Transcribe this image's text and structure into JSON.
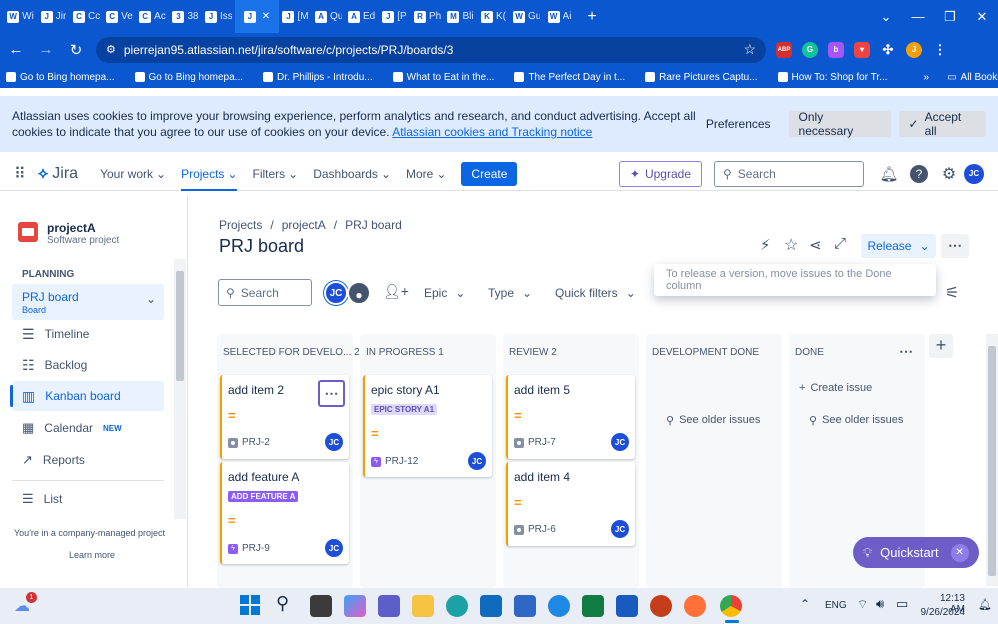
{
  "browser": {
    "tabs": [
      {
        "label": "Wi",
        "fav": "W"
      },
      {
        "label": "Jir",
        "fav": "J"
      },
      {
        "label": "Cc",
        "fav": "C"
      },
      {
        "label": "Ve",
        "fav": "C"
      },
      {
        "label": "Ac",
        "fav": "C"
      },
      {
        "label": "38",
        "fav": "3"
      },
      {
        "label": "Iss",
        "fav": "J"
      },
      {
        "label": "",
        "fav": "J"
      },
      {
        "label": "[M",
        "fav": "J"
      },
      {
        "label": "Qu",
        "fav": "A"
      },
      {
        "label": "Ed",
        "fav": "A"
      },
      {
        "label": "[P",
        "fav": "J"
      },
      {
        "label": "Ph",
        "fav": "R"
      },
      {
        "label": "Bli",
        "fav": "M"
      },
      {
        "label": "K(",
        "fav": "K"
      },
      {
        "label": "Gu",
        "fav": "W"
      },
      {
        "label": "Ai",
        "fav": "W"
      }
    ],
    "new_tab": "+",
    "url": "pierrejan95.atlassian.net/jira/software/c/projects/PRJ/boards/3",
    "profile_initial": "J",
    "bookmarks": [
      "Go to Bing homepa...",
      "Go to Bing homepa...",
      "Dr. Phillips - Introdu...",
      "What to Eat in the...",
      "The Perfect Day in t...",
      "Rare Pictures Captu...",
      "How To: Shop for Tr..."
    ],
    "all_bookmarks": "All Bookmarks",
    "ext_abp": "ABP"
  },
  "cookie": {
    "text": "Atlassian uses cookies to improve your browsing experience, perform analytics and research, and conduct advertising. Accept all cookies to indicate that you agree to our use of cookies on your device. ",
    "link": "Atlassian cookies and Tracking notice",
    "preferences": "Preferences",
    "only_necessary": "Only necessary",
    "accept_all": "Accept all"
  },
  "nav": {
    "logo": "Jira",
    "your_work": "Your work",
    "projects": "Projects",
    "filters": "Filters",
    "dashboards": "Dashboards",
    "more": "More",
    "create": "Create",
    "upgrade": "Upgrade",
    "search_placeholder": "Search",
    "user_initials": "JC"
  },
  "sidebar": {
    "project_name": "projectA",
    "project_type": "Software project",
    "section": "PLANNING",
    "board_name": "PRJ board",
    "board_sub": "Board",
    "items": [
      "Timeline",
      "Backlog",
      "Kanban board",
      "Calendar",
      "Reports",
      "List"
    ],
    "calendar_badge": "NEW",
    "footer": "You're in a company-managed project",
    "learn_more": "Learn more"
  },
  "board": {
    "breadcrumb": [
      "Projects",
      "projectA",
      "PRJ board"
    ],
    "title": "PRJ board",
    "release": "Release",
    "tooltip": "To release a version, move issues to the Done column",
    "search_placeholder": "Search",
    "assignee_initials": "JC",
    "epic": "Epic",
    "type": "Type",
    "quick_filters": "Quick filters",
    "columns": [
      {
        "title": "SELECTED FOR DEVELO...",
        "count": "2"
      },
      {
        "title": "IN PROGRESS",
        "count": "1"
      },
      {
        "title": "REVIEW",
        "count": "2"
      },
      {
        "title": "DEVELOPMENT DONE",
        "count": ""
      },
      {
        "title": "DONE",
        "count": ""
      }
    ],
    "cards": {
      "c1": {
        "title": "add item 2",
        "key": "PRJ-2",
        "prio": "="
      },
      "c2": {
        "title": "add feature A",
        "epic": "ADD FEATURE A",
        "key": "PRJ-9",
        "prio": "="
      },
      "c3": {
        "title": "epic story A1",
        "epic": "EPIC STORY A1",
        "key": "PRJ-12",
        "prio": "="
      },
      "c4": {
        "title": "add item 5",
        "key": "PRJ-7",
        "prio": "="
      },
      "c5": {
        "title": "add item 4",
        "key": "PRJ-6",
        "prio": "="
      }
    },
    "see_older": "See older issues",
    "create_issue": "Create issue",
    "quickstart": "Quickstart"
  },
  "taskbar": {
    "lang": "ENG",
    "time": "12:13 AM",
    "date": "9/26/2024",
    "weather_badge": "1"
  }
}
